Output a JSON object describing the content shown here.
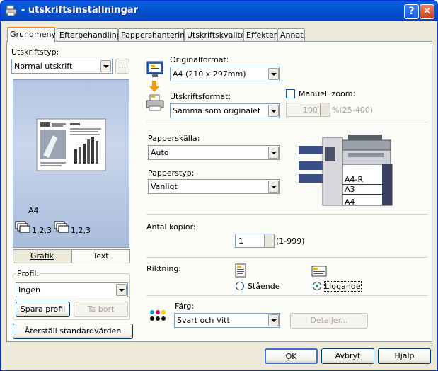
{
  "window": {
    "title": "- utskriftsinställningar",
    "help_label": "?",
    "close_label": "✕"
  },
  "tabs": [
    "Grundmeny",
    "Efterbehandling",
    "Pappershantering",
    "Utskriftskvalitet",
    "Effekter",
    "Annat"
  ],
  "left": {
    "print_type_label": "Utskriftstyp:",
    "print_type_value": "Normal utskrift",
    "dots_label": "...",
    "preview_paper": "A4",
    "collate_1": "1,2,3",
    "collate_2": "1,2,3",
    "tab_graphics": "Grafik",
    "tab_text": "Text",
    "profile_label": "Profil:",
    "profile_value": "Ingen",
    "save_profile": "Spara profil",
    "delete": "Ta bort",
    "reset_defaults": "Återställ standardvärden"
  },
  "right": {
    "original_format_label": "Originalformat:",
    "original_format_value": "A4 (210 x 297mm)",
    "output_format_label": "Utskriftsformat:",
    "output_format_value": "Samma som originalet",
    "manual_zoom_label": "Manuell zoom:",
    "zoom_value": "100",
    "zoom_range": "%(25-400)",
    "paper_source_label": "Papperskälla:",
    "paper_source_value": "Auto",
    "paper_type_label": "Papperstyp:",
    "paper_type_value": "Vanligt",
    "trays": [
      "A4-R",
      "A3",
      "A4"
    ],
    "copies_label": "Antal kopior:",
    "copies_value": "1",
    "copies_range": "(1-999)",
    "orientation_label": "Riktning:",
    "portrait": "Stående",
    "landscape": "Liggande",
    "color_label": "Färg:",
    "color_value": "Svart och Vitt",
    "details": "Detaljer..."
  },
  "footer": {
    "ok": "OK",
    "cancel": "Avbryt",
    "help": "Hjälp"
  }
}
